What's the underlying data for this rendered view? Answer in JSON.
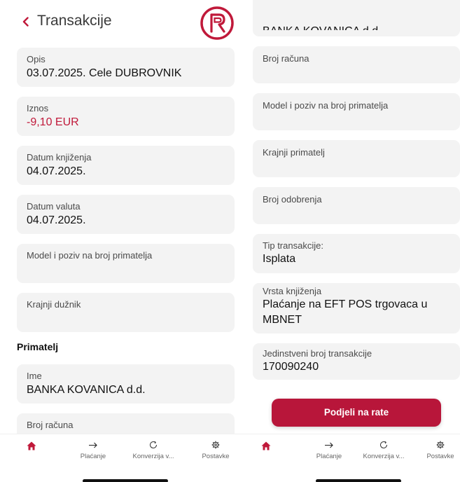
{
  "header": {
    "title": "Transakcije"
  },
  "left_cards": [
    {
      "label": "Opis",
      "value": "03.07.2025. Cele DUBROVNIK"
    },
    {
      "label": "Iznos",
      "value": "-9,10 EUR"
    },
    {
      "label": "Datum knjiženja",
      "value": "04.07.2025."
    },
    {
      "label": "Datum valuta",
      "value": "04.07.2025."
    },
    {
      "label": "Model i poziv na broj primatelja",
      "value": ""
    },
    {
      "label": "Krajnji dužnik",
      "value": ""
    }
  ],
  "recipient_section": {
    "title": "Primatelj",
    "cards": [
      {
        "label": "Ime",
        "value": "BANKA KOVANICA d.d."
      },
      {
        "label": "Broj računa",
        "value": ""
      }
    ]
  },
  "right_cards": [
    {
      "label": "Broj računa",
      "value": ""
    },
    {
      "label": "Model i poziv na broj primatelja",
      "value": ""
    },
    {
      "label": "Krajnji primatelj",
      "value": ""
    },
    {
      "label": "Broj odobrenja",
      "value": ""
    },
    {
      "label": "Tip transakcije:",
      "value": "Isplata"
    },
    {
      "label": "Vrsta knjiženja",
      "value": "Plaćanje na EFT POS trgovaca u",
      "value_line2": "MBNET"
    },
    {
      "label": "Jedinstveni broj transakcije",
      "value": "170090240"
    }
  ],
  "actions": {
    "split_button": "Podjeli na rate"
  },
  "tabbar": {
    "tabs": [
      {
        "name": "home",
        "label": "",
        "icon": "home-icon"
      },
      {
        "name": "payments",
        "label": "Plaćanje",
        "icon": "arrow-right-icon"
      },
      {
        "name": "conversion",
        "label": "Konverzija v...",
        "icon": "refresh-icon"
      },
      {
        "name": "settings",
        "label": "Postavke",
        "icon": "gear-icon"
      }
    ]
  },
  "colors": {
    "accent": "#c0193a",
    "card_bg": "#f3f3f3",
    "button_bg": "#b8163a"
  }
}
